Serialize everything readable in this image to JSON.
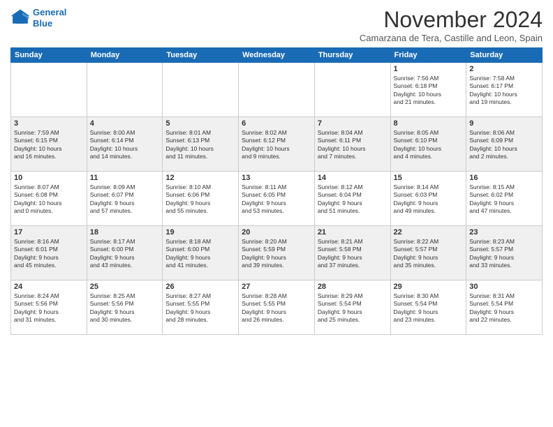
{
  "header": {
    "logo_line1": "General",
    "logo_line2": "Blue",
    "month": "November 2024",
    "location": "Camarzana de Tera, Castille and Leon, Spain"
  },
  "weekdays": [
    "Sunday",
    "Monday",
    "Tuesday",
    "Wednesday",
    "Thursday",
    "Friday",
    "Saturday"
  ],
  "weeks": [
    [
      {
        "day": "",
        "info": ""
      },
      {
        "day": "",
        "info": ""
      },
      {
        "day": "",
        "info": ""
      },
      {
        "day": "",
        "info": ""
      },
      {
        "day": "",
        "info": ""
      },
      {
        "day": "1",
        "info": "Sunrise: 7:56 AM\nSunset: 6:18 PM\nDaylight: 10 hours\nand 21 minutes."
      },
      {
        "day": "2",
        "info": "Sunrise: 7:58 AM\nSunset: 6:17 PM\nDaylight: 10 hours\nand 19 minutes."
      }
    ],
    [
      {
        "day": "3",
        "info": "Sunrise: 7:59 AM\nSunset: 6:15 PM\nDaylight: 10 hours\nand 16 minutes."
      },
      {
        "day": "4",
        "info": "Sunrise: 8:00 AM\nSunset: 6:14 PM\nDaylight: 10 hours\nand 14 minutes."
      },
      {
        "day": "5",
        "info": "Sunrise: 8:01 AM\nSunset: 6:13 PM\nDaylight: 10 hours\nand 11 minutes."
      },
      {
        "day": "6",
        "info": "Sunrise: 8:02 AM\nSunset: 6:12 PM\nDaylight: 10 hours\nand 9 minutes."
      },
      {
        "day": "7",
        "info": "Sunrise: 8:04 AM\nSunset: 6:11 PM\nDaylight: 10 hours\nand 7 minutes."
      },
      {
        "day": "8",
        "info": "Sunrise: 8:05 AM\nSunset: 6:10 PM\nDaylight: 10 hours\nand 4 minutes."
      },
      {
        "day": "9",
        "info": "Sunrise: 8:06 AM\nSunset: 6:09 PM\nDaylight: 10 hours\nand 2 minutes."
      }
    ],
    [
      {
        "day": "10",
        "info": "Sunrise: 8:07 AM\nSunset: 6:08 PM\nDaylight: 10 hours\nand 0 minutes."
      },
      {
        "day": "11",
        "info": "Sunrise: 8:09 AM\nSunset: 6:07 PM\nDaylight: 9 hours\nand 57 minutes."
      },
      {
        "day": "12",
        "info": "Sunrise: 8:10 AM\nSunset: 6:06 PM\nDaylight: 9 hours\nand 55 minutes."
      },
      {
        "day": "13",
        "info": "Sunrise: 8:11 AM\nSunset: 6:05 PM\nDaylight: 9 hours\nand 53 minutes."
      },
      {
        "day": "14",
        "info": "Sunrise: 8:12 AM\nSunset: 6:04 PM\nDaylight: 9 hours\nand 51 minutes."
      },
      {
        "day": "15",
        "info": "Sunrise: 8:14 AM\nSunset: 6:03 PM\nDaylight: 9 hours\nand 49 minutes."
      },
      {
        "day": "16",
        "info": "Sunrise: 8:15 AM\nSunset: 6:02 PM\nDaylight: 9 hours\nand 47 minutes."
      }
    ],
    [
      {
        "day": "17",
        "info": "Sunrise: 8:16 AM\nSunset: 6:01 PM\nDaylight: 9 hours\nand 45 minutes."
      },
      {
        "day": "18",
        "info": "Sunrise: 8:17 AM\nSunset: 6:00 PM\nDaylight: 9 hours\nand 43 minutes."
      },
      {
        "day": "19",
        "info": "Sunrise: 8:18 AM\nSunset: 6:00 PM\nDaylight: 9 hours\nand 41 minutes."
      },
      {
        "day": "20",
        "info": "Sunrise: 8:20 AM\nSunset: 5:59 PM\nDaylight: 9 hours\nand 39 minutes."
      },
      {
        "day": "21",
        "info": "Sunrise: 8:21 AM\nSunset: 5:58 PM\nDaylight: 9 hours\nand 37 minutes."
      },
      {
        "day": "22",
        "info": "Sunrise: 8:22 AM\nSunset: 5:57 PM\nDaylight: 9 hours\nand 35 minutes."
      },
      {
        "day": "23",
        "info": "Sunrise: 8:23 AM\nSunset: 5:57 PM\nDaylight: 9 hours\nand 33 minutes."
      }
    ],
    [
      {
        "day": "24",
        "info": "Sunrise: 8:24 AM\nSunset: 5:56 PM\nDaylight: 9 hours\nand 31 minutes."
      },
      {
        "day": "25",
        "info": "Sunrise: 8:25 AM\nSunset: 5:56 PM\nDaylight: 9 hours\nand 30 minutes."
      },
      {
        "day": "26",
        "info": "Sunrise: 8:27 AM\nSunset: 5:55 PM\nDaylight: 9 hours\nand 28 minutes."
      },
      {
        "day": "27",
        "info": "Sunrise: 8:28 AM\nSunset: 5:55 PM\nDaylight: 9 hours\nand 26 minutes."
      },
      {
        "day": "28",
        "info": "Sunrise: 8:29 AM\nSunset: 5:54 PM\nDaylight: 9 hours\nand 25 minutes."
      },
      {
        "day": "29",
        "info": "Sunrise: 8:30 AM\nSunset: 5:54 PM\nDaylight: 9 hours\nand 23 minutes."
      },
      {
        "day": "30",
        "info": "Sunrise: 8:31 AM\nSunset: 5:54 PM\nDaylight: 9 hours\nand 22 minutes."
      }
    ]
  ]
}
